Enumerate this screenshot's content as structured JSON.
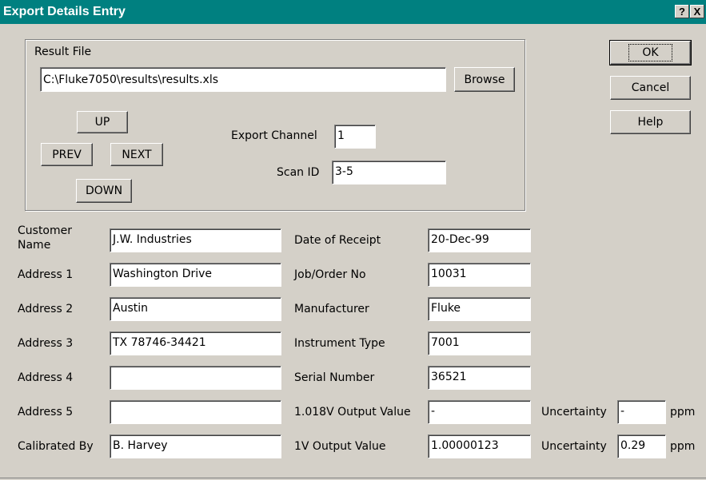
{
  "window": {
    "title": "Export Details Entry",
    "help_glyph": "?",
    "close_glyph": "X"
  },
  "result_file": {
    "label": "Result File",
    "path": "C:\\Fluke7050\\results\\results.xls",
    "browse_label": "Browse"
  },
  "nav": {
    "up": "UP",
    "prev": "PREV",
    "next": "NEXT",
    "down": "DOWN"
  },
  "export_channel": {
    "label": "Export Channel",
    "value": "1"
  },
  "scan_id": {
    "label": "Scan ID",
    "value": "3-5"
  },
  "dialog_buttons": {
    "ok": "OK",
    "cancel": "Cancel",
    "help": "Help"
  },
  "customer": {
    "name_label_line1": "Customer",
    "name_label_line2": "Name",
    "name": "J.W. Industries",
    "address1_label": "Address 1",
    "address1": "Washington Drive",
    "address2_label": "Address 2",
    "address2": "Austin",
    "address3_label": "Address 3",
    "address3": "TX 78746-34421",
    "address4_label": "Address 4",
    "address4": "",
    "address5_label": "Address 5",
    "address5": "",
    "calibrated_by_label": "Calibrated By",
    "calibrated_by": "B. Harvey"
  },
  "instrument": {
    "date_label": "Date of Receipt",
    "date": "20-Dec-99",
    "job_label": "Job/Order No",
    "job": "10031",
    "manufacturer_label": "Manufacturer",
    "manufacturer": "Fluke",
    "type_label": "Instrument Type",
    "type": "7001",
    "serial_label": "Serial Number",
    "serial": "36521",
    "out1018_label": "1.018V Output Value",
    "out1018": "-",
    "out1v_label": "1V Output Value",
    "out1v": "1.00000123"
  },
  "uncertainty": {
    "label": "Uncertainty",
    "unit": "ppm",
    "value_1018": "-",
    "value_1v": "0.29"
  }
}
